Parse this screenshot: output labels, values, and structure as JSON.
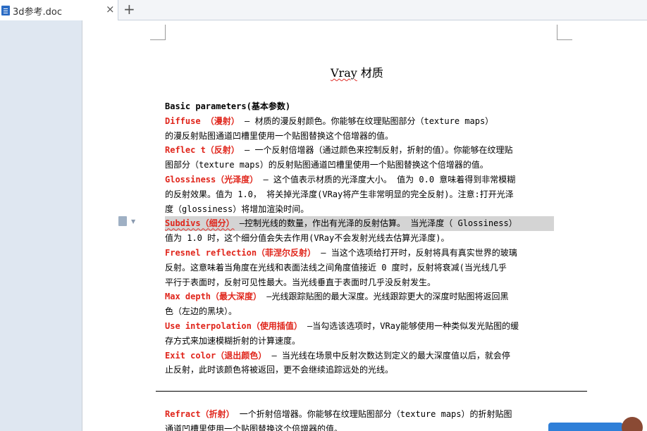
{
  "tab": {
    "title": "3d参考.doc",
    "close": "×",
    "new": "+"
  },
  "doc": {
    "title_word": "Vray",
    "title_rest": " 材质",
    "heading": "Basic parameters(基本参数)",
    "lines": [
      {
        "term": "Diffuse （漫射）",
        "text": " – 材质的漫反射颜色。你能够在纹理贴图部分（texture maps）"
      },
      {
        "term": "",
        "text": "的漫反射贴图通道凹槽里使用一个贴图替换这个倍增器的值。"
      },
      {
        "term": "Reflec t（反射）",
        "text": " – 一个反射倍增器（通过颜色来控制反射，折射的值）。你能够在纹理贴"
      },
      {
        "term": "",
        "text": "图部分（texture maps）的反射贴图通道凹槽里使用一个贴图替换这个倍增器的值。"
      },
      {
        "term": "Glossiness（光泽度）",
        "text": " – 这个值表示材质的光泽度大小。 值为 0.0 意味着得到非常模糊"
      },
      {
        "term": "",
        "text": "的反射效果。值为 1.0， 将关掉光泽度(VRay将产生非常明显的完全反射)。注意:打开光泽"
      },
      {
        "term": "",
        "text": "度（glossiness）将增加渲染时间。"
      },
      {
        "term": "Subdivs（细分）",
        "text": " –控制光线的数量，作出有光泽的反射估算。 当光泽度（ Glossiness）"
      },
      {
        "term": "",
        "text": "值为 1.0 时，这个细分值会失去作用(VRay不会发射光线去估算光泽度)。"
      },
      {
        "term": "Fresnel reflection（菲涅尔反射）",
        "text": " – 当这个选项给打开时，反射将具有真实世界的玻璃"
      },
      {
        "term": "",
        "text": "反射。这意味着当角度在光线和表面法线之间角度值接近 0 度时，反射将衰减(当光线几乎"
      },
      {
        "term": "",
        "text": "平行于表面时，反射可见性最大。当光线垂直于表面时几乎没反射发生。"
      },
      {
        "term": "Max depth（最大深度）",
        "text": " –光线跟踪贴图的最大深度。光线跟踪更大的深度时贴图将返回黑"
      },
      {
        "term": "",
        "text": "色（左边的黑块）。"
      },
      {
        "term": "Use interpolation（使用插值）",
        "text": " –当勾选该选项时，VRay能够使用一种类似发光贴图的缓"
      },
      {
        "term": "",
        "text": "存方式来加速模糊折射的计算速度。"
      },
      {
        "term": "Exit color（退出颜色）",
        "text": " – 当光线在场景中反射次数达到定义的最大深度值以后，就会停"
      },
      {
        "term": "",
        "text": "止反射，此时该颜色将被返回，更不会继续追踪远处的光线。"
      }
    ],
    "bottom_lines": [
      {
        "term": "Refract（折射）",
        "text": " 一个折射倍增器。你能够在纹理贴图部分（texture maps）的折射贴图"
      },
      {
        "term": "",
        "text": "通道凹槽里使用一个贴图替换这个倍增器的值。"
      }
    ]
  },
  "colors": {
    "term": "#e0251b",
    "highlight": "#d4d4d4",
    "background": "#dfe7f1"
  },
  "icons": {
    "doc": "word-doc-icon",
    "paragraph": "paragraph-options-icon"
  }
}
